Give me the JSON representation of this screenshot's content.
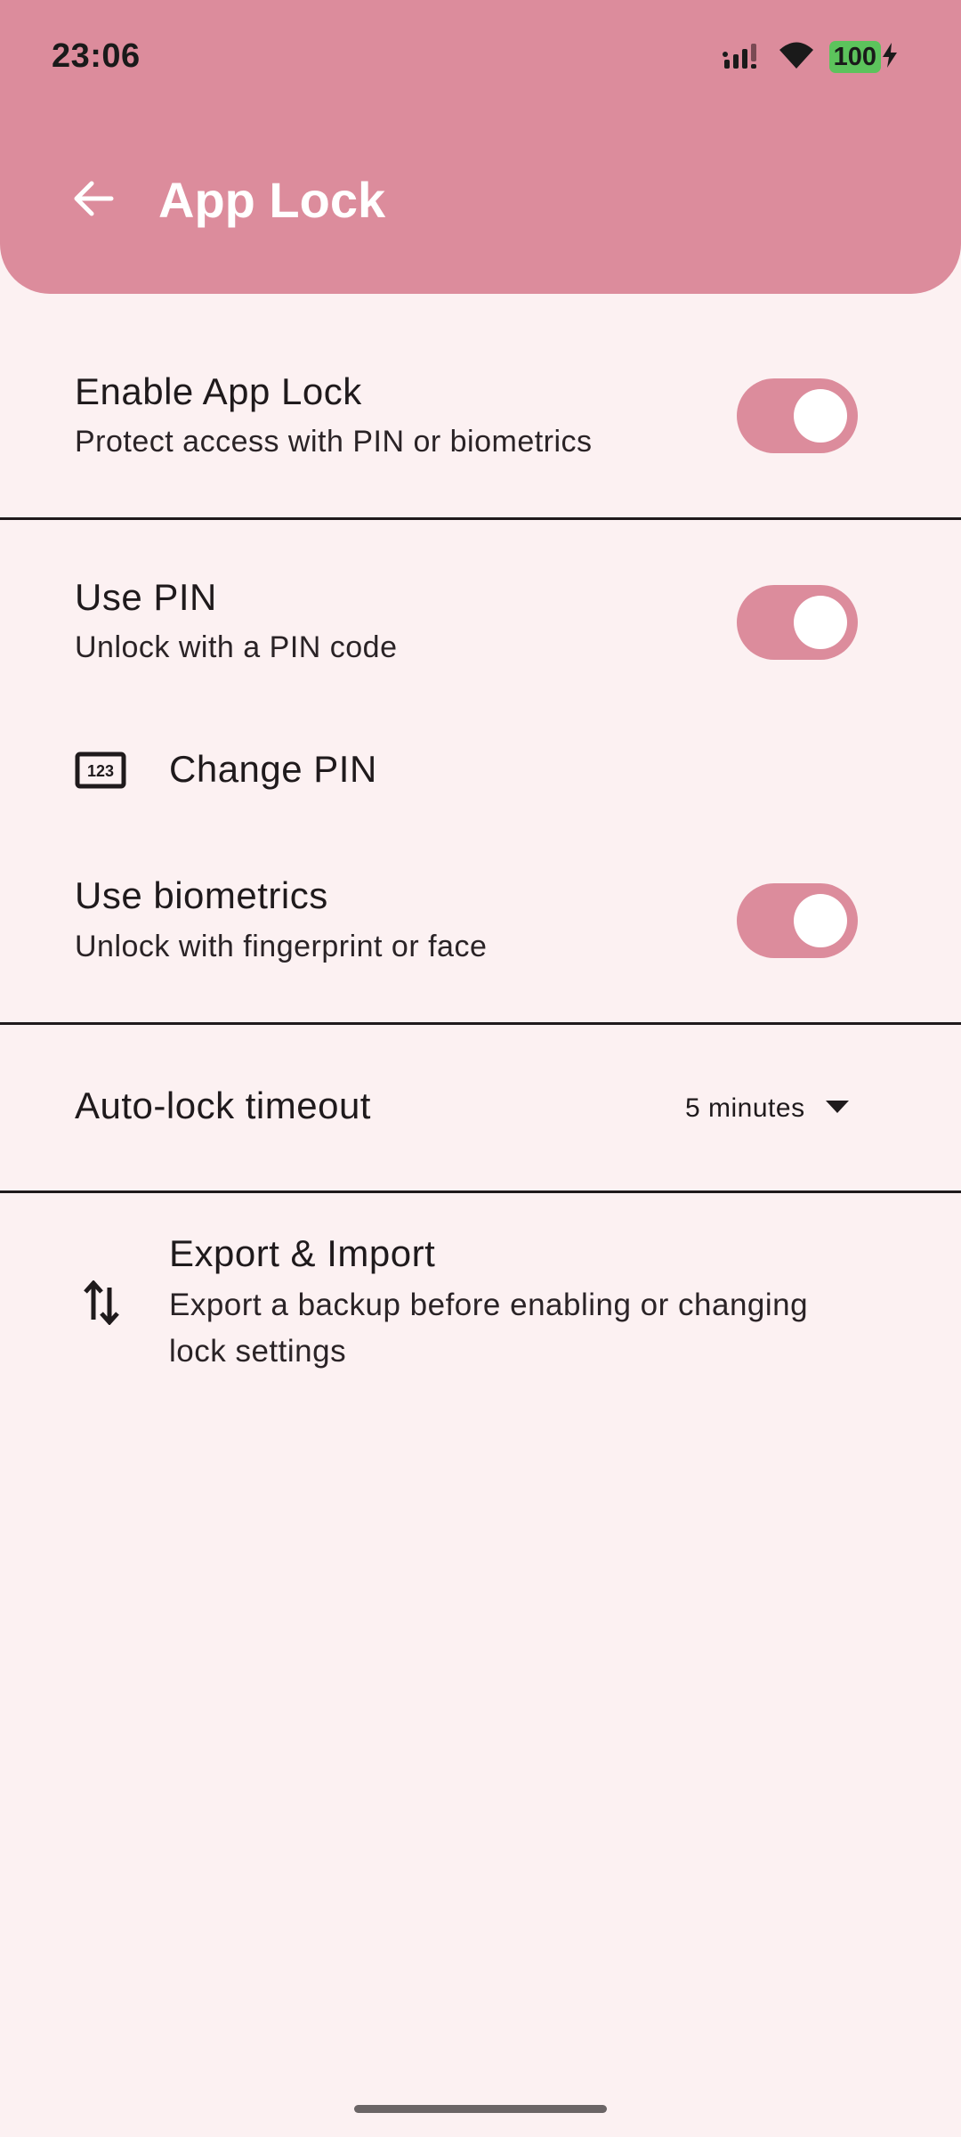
{
  "status_bar": {
    "time": "23:06",
    "battery_level": "100",
    "icons": [
      "signal-icon",
      "wifi-icon",
      "battery-icon",
      "charging-icon"
    ]
  },
  "appbar": {
    "title": "App Lock",
    "back_icon": "arrow-back-icon"
  },
  "settings": {
    "enable_app_lock": {
      "title": "Enable App Lock",
      "subtitle": "Protect access with PIN or biometrics",
      "enabled": true
    },
    "use_pin": {
      "title": "Use PIN",
      "subtitle": "Unlock with a PIN code",
      "enabled": true
    },
    "change_pin": {
      "title": "Change PIN",
      "icon": "pin-123-icon"
    },
    "use_biometrics": {
      "title": "Use biometrics",
      "subtitle": "Unlock with fingerprint or face",
      "enabled": true
    },
    "auto_lock": {
      "title": "Auto-lock timeout",
      "value": "5 minutes"
    },
    "export_import": {
      "title": "Export & Import",
      "subtitle_line1": "Export a backup before enabling or changing",
      "subtitle_line2": "lock settings",
      "icon": "swap-vertical-icon"
    }
  },
  "colors": {
    "accent": "#dc8c9c",
    "background": "#fcf1f2",
    "text": "#1f1a1c"
  }
}
